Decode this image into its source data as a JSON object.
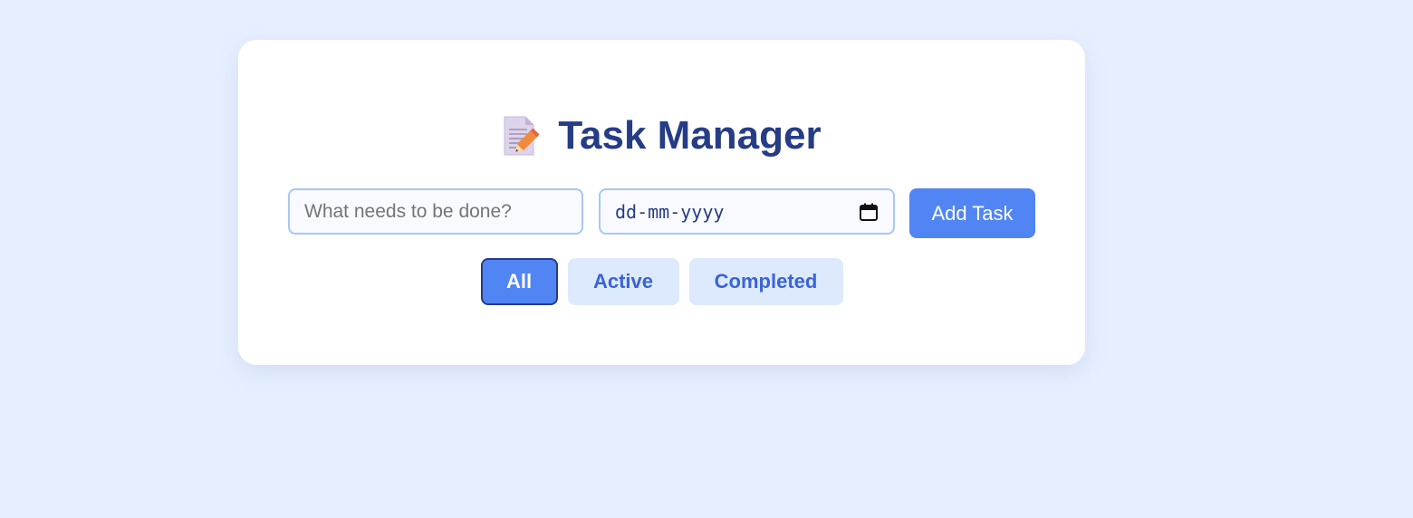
{
  "app": {
    "title": "Task Manager",
    "title_icon": "memo-icon"
  },
  "form": {
    "task_placeholder": "What needs to be done?",
    "task_value": "",
    "date_placeholder": "dd-mm-yyyy",
    "date_value": "",
    "calendar_icon": "calendar-icon",
    "add_label": "Add Task"
  },
  "filters": {
    "all_label": "All",
    "active_label": "Active",
    "completed_label": "Completed",
    "selected": "All"
  },
  "colors": {
    "page_background": "#e6effe",
    "title": "#253c86",
    "primary_button": "#5185f4",
    "filter_inactive_bg": "#dde9fd",
    "filter_inactive_text": "#3a63d8",
    "input_border": "#a9c6f4"
  }
}
